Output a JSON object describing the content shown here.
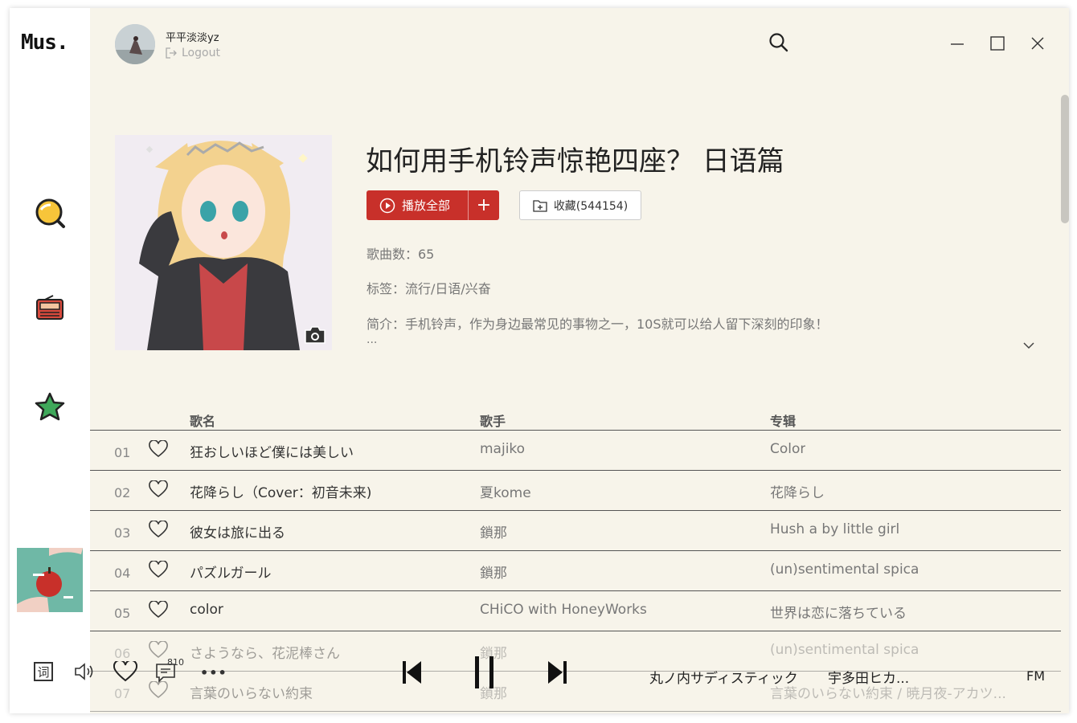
{
  "app": {
    "logo": "Mus."
  },
  "user": {
    "name": "平平淡淡yz",
    "logout_label": "Logout"
  },
  "sidebar": {
    "items": [
      {
        "icon": "search-bubble-icon"
      },
      {
        "icon": "radio-icon"
      },
      {
        "icon": "star-icon"
      }
    ]
  },
  "playlist": {
    "title": "如何用手机铃声惊艳四座？ 日语篇",
    "play_all_label": "播放全部",
    "add_label": "+",
    "collect_label": "收藏(544154)",
    "song_count_label": "歌曲数：65",
    "tags_label": "标签：流行/日语/兴奋",
    "desc_label": "简介：手机铃声，作为身边最常见的事物之一，10S就可以给人留下深刻的印象！",
    "desc_more": "..."
  },
  "table": {
    "headers": {
      "song": "歌名",
      "artist": "歌手",
      "album": "专辑"
    },
    "rows": [
      {
        "num": "01",
        "song": "狂おしいほど僕には美しい",
        "artist": "majiko",
        "album": "Color"
      },
      {
        "num": "02",
        "song": "花降らし（Cover：初音未来)",
        "artist": "夏kome",
        "album": "花降らし"
      },
      {
        "num": "03",
        "song": "彼女は旅に出る",
        "artist": "鎖那",
        "album": "Hush a by little girl"
      },
      {
        "num": "04",
        "song": "パズルガール",
        "artist": "鎖那",
        "album": "(un)sentimental spica"
      },
      {
        "num": "05",
        "song": "color",
        "artist": "CHiCO with HoneyWorks",
        "album": "世界は恋に落ちている"
      },
      {
        "num": "06",
        "song": "さようなら、花泥棒さん",
        "artist": "鎖那",
        "album": "(un)sentimental spica"
      },
      {
        "num": "07",
        "song": "言葉のいらない約束",
        "artist": "鎖那",
        "album": "言葉のいらない約束 / 暁月夜-アカツ..."
      }
    ]
  },
  "player": {
    "lyric_label": "词",
    "comment_count": "810",
    "more_label": "•••",
    "now_playing_title": "丸ノ内サディスティック",
    "now_playing_artist": "宇多田ヒカ...",
    "fm_label": "FM"
  },
  "colors": {
    "accent": "#c8302a",
    "background": "#f7f4ea"
  }
}
